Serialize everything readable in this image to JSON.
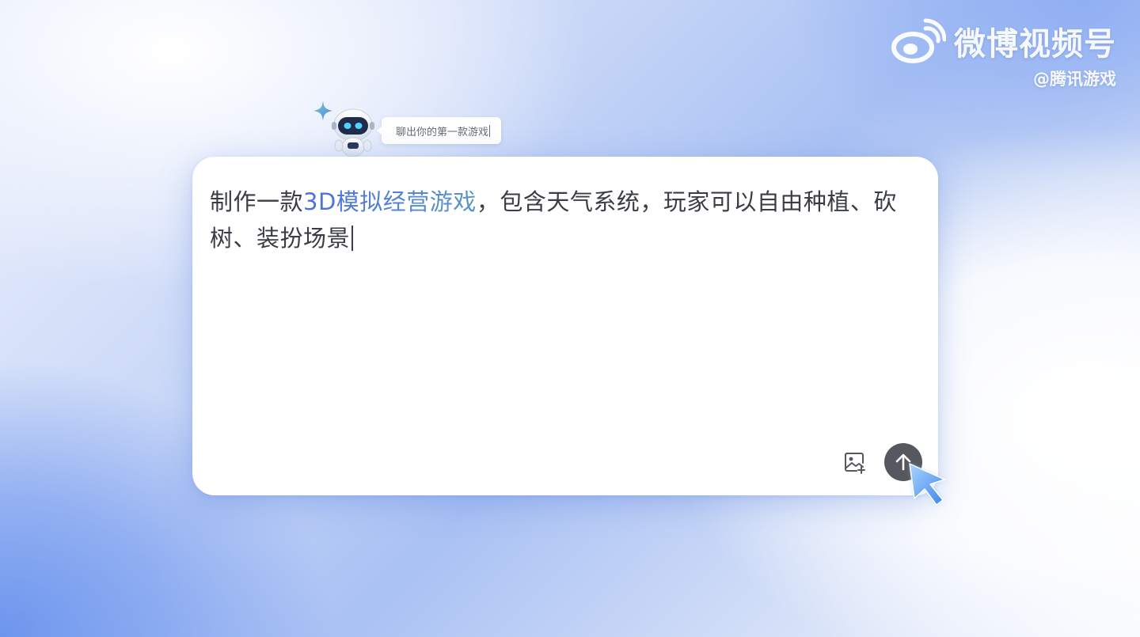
{
  "watermark": {
    "brand": "微博视频号",
    "handle": "@腾讯游戏"
  },
  "assistant": {
    "bubble_text": "聊出你的第一款游戏"
  },
  "prompt": {
    "text_before": "制作一款",
    "highlight": "3D模拟经营游戏",
    "text_after": "，包含天气系统，玩家可以自由种植、砍树、装扮场景"
  },
  "icons": {
    "upload": "image-upload-icon",
    "send": "arrow-up-icon",
    "cursor": "mouse-pointer-icon",
    "logo": "weibo-logo-icon",
    "robot": "robot-mascot-icon",
    "sparkle": "sparkle-icon"
  },
  "colors": {
    "highlight_start": "#4b6fe0",
    "highlight_end": "#5a95c8",
    "send_button": "#55585e",
    "cursor": "#5b9df0"
  }
}
